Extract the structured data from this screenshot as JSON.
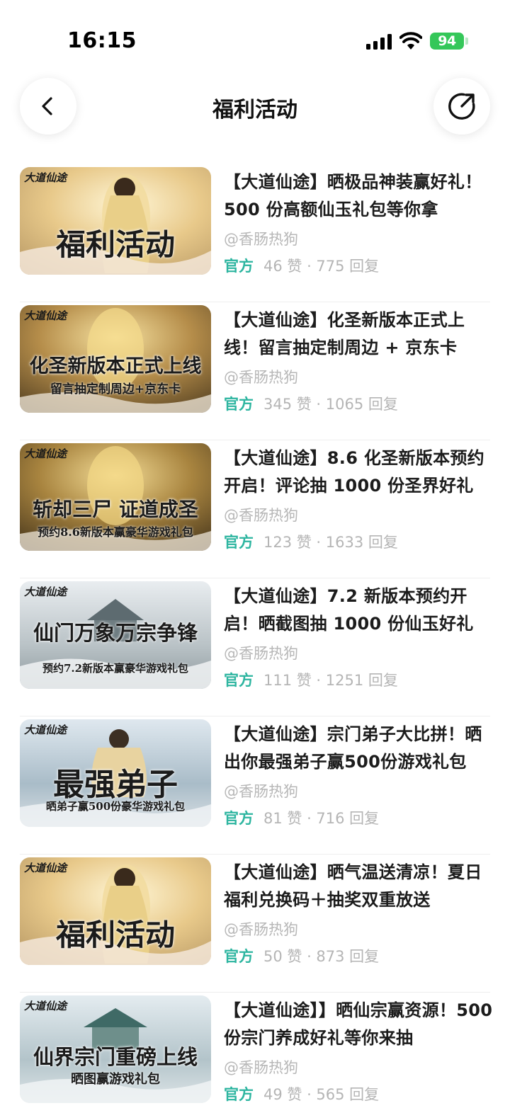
{
  "status": {
    "time": "16:15",
    "battery": "94"
  },
  "header": {
    "title": "福利活动"
  },
  "icons": {
    "back": "chevron-left-icon",
    "share": "share-external-icon"
  },
  "posts": [
    {
      "thumb_logo": "大道仙途",
      "thumb_main": "福利活动",
      "thumb_sub": "",
      "title": "【大道仙途】晒极品神装赢好礼！500 份高额仙玉礼包等你拿",
      "author": "@香肠热狗",
      "badge": "官方",
      "stats": "46 赞 · 775 回复"
    },
    {
      "thumb_logo": "大道仙途",
      "thumb_main": "化圣新版本正式上线",
      "thumb_sub": "留言抽定制周边+京东卡",
      "title": "【大道仙途】化圣新版本正式上线！留言抽定制周边 + 京东卡",
      "author": "@香肠热狗",
      "badge": "官方",
      "stats": "345 赞 · 1065 回复"
    },
    {
      "thumb_logo": "大道仙途",
      "thumb_main": "斩却三尸 证道成圣",
      "thumb_sub": "预约8.6新版本赢豪华游戏礼包",
      "title": "【大道仙途】8.6 化圣新版本预约开启！评论抽 1000 份圣界好礼",
      "author": "@香肠热狗",
      "badge": "官方",
      "stats": "123 赞 · 1633 回复"
    },
    {
      "thumb_logo": "大道仙途",
      "thumb_main": "仙门万象万宗争锋",
      "thumb_sub": "预约7.2新版本赢豪华游戏礼包",
      "title": "【大道仙途】7.2 新版本预约开启！晒截图抽 1000 份仙玉好礼",
      "author": "@香肠热狗",
      "badge": "官方",
      "stats": "111 赞 · 1251 回复"
    },
    {
      "thumb_logo": "大道仙途",
      "thumb_main": "最强弟子",
      "thumb_sub": "晒弟子赢500份豪华游戏礼包",
      "title": "【大道仙途】宗门弟子大比拼！晒出你最强弟子赢500份游戏礼包",
      "author": "@香肠热狗",
      "badge": "官方",
      "stats": "81 赞 · 716 回复"
    },
    {
      "thumb_logo": "大道仙途",
      "thumb_main": "福利活动",
      "thumb_sub": "",
      "title": "【大道仙途】晒气温送清凉！夏日福利兑换码＋抽奖双重放送",
      "author": "@香肠热狗",
      "badge": "官方",
      "stats": "50 赞 · 873 回复"
    },
    {
      "thumb_logo": "大道仙途",
      "thumb_main": "仙界宗门重磅上线",
      "thumb_sub": "晒图赢游戏礼包",
      "title": "【大道仙途】】晒仙宗赢资源！500 份宗门养成好礼等你来抽",
      "author": "@香肠热狗",
      "badge": "官方",
      "stats": "49 赞 · 565 回复"
    }
  ]
}
